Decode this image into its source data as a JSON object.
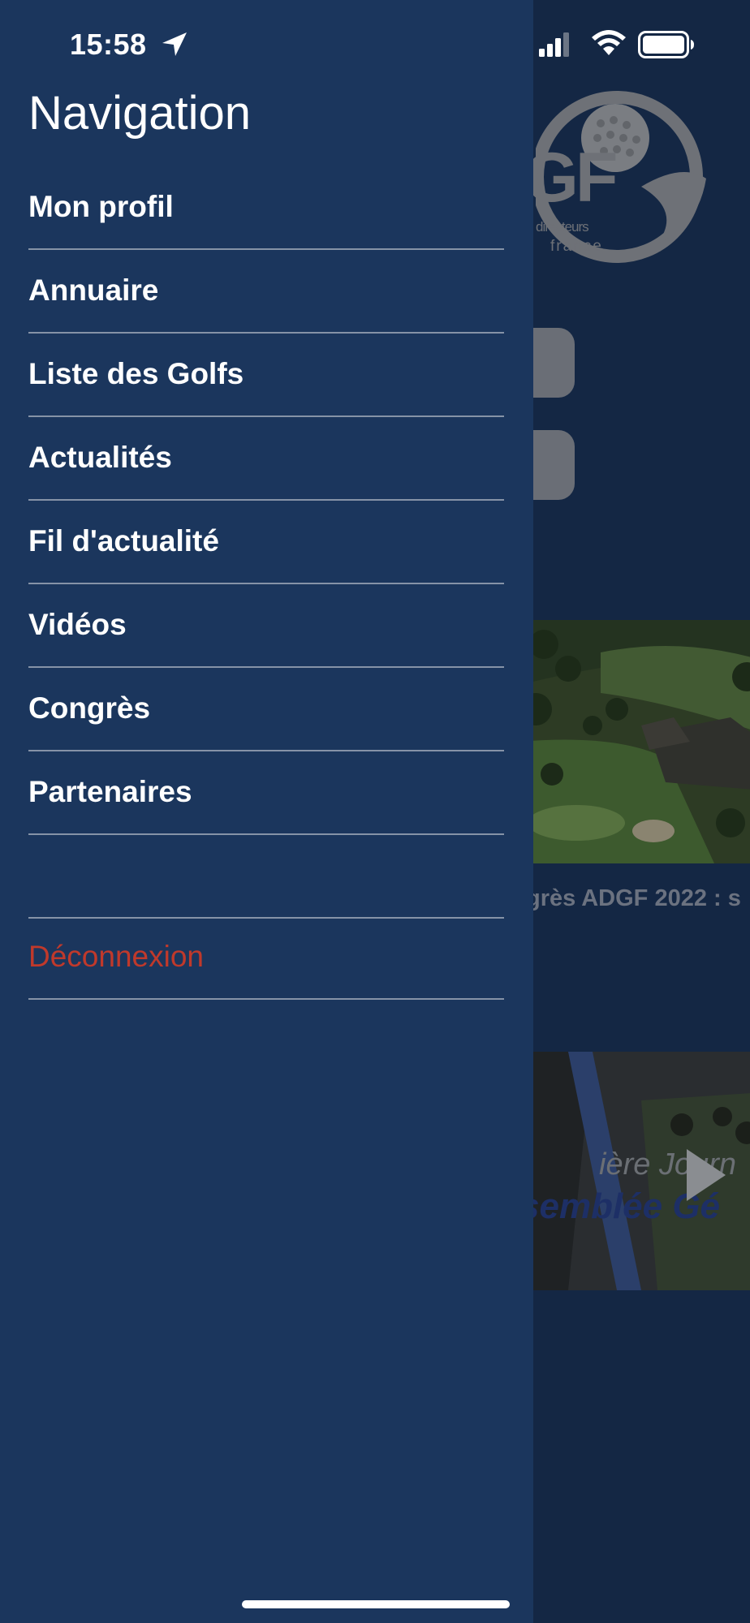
{
  "status_bar": {
    "time": "15:58"
  },
  "drawer": {
    "title": "Navigation",
    "items": [
      {
        "label": "Mon profil"
      },
      {
        "label": "Annuaire"
      },
      {
        "label": "Liste des Golfs"
      },
      {
        "label": "Actualités"
      },
      {
        "label": "Fil d'actualité"
      },
      {
        "label": "Vidéos"
      },
      {
        "label": "Congrès"
      },
      {
        "label": "Partenaires"
      }
    ],
    "logout_label": "Déconnexion",
    "logout_color": "#c0392b",
    "background_color": "#1b365d"
  },
  "background": {
    "logo_letters": "GF",
    "logo_line1": "directeurs",
    "logo_line2": "france",
    "news_title_line1": "grès ADGF 2022 : s",
    "news_title_line2": "!",
    "video_line1": "ière Journ",
    "video_line2": "semblée Gé"
  }
}
